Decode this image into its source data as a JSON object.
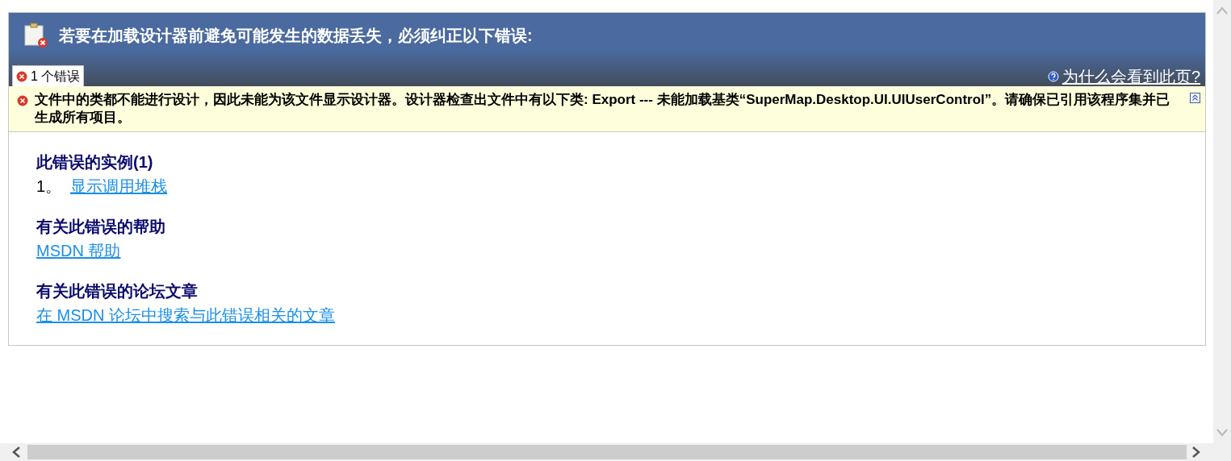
{
  "header": {
    "title": "若要在加载设计器前避免可能发生的数据丢失，必须纠正以下错误:"
  },
  "tabs": [
    {
      "label": "1 个错误",
      "selected": true
    }
  ],
  "help_link": "为什么会看到此页?",
  "error": {
    "message": "文件中的类都不能进行设计，因此未能为该文件显示设计器。设计器检查出文件中有以下类: Export --- 未能加载基类“SuperMap.Desktop.UI.UIUserControl”。请确保已引用该程序集并已生成所有项目。",
    "expanded": true
  },
  "sections": [
    {
      "heading": "此错误的实例(1)",
      "items": [
        {
          "number": "1。",
          "link": "显示调用堆栈"
        }
      ]
    },
    {
      "heading": "有关此错误的帮助",
      "items": [
        {
          "link": "MSDN 帮助"
        }
      ]
    },
    {
      "heading": "有关此错误的论坛文章",
      "items": [
        {
          "link": "在 MSDN 论坛中搜索与此错误相关的文章"
        }
      ]
    }
  ]
}
